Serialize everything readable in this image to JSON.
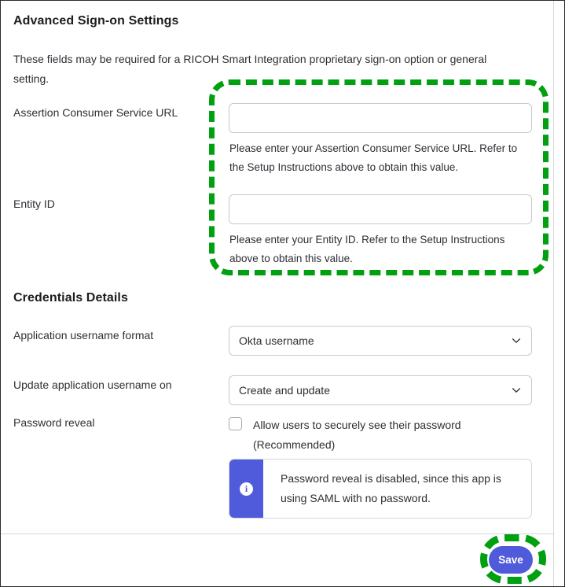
{
  "page": {
    "advanced_section_title": "Advanced Sign-on Settings",
    "intro_text": "These fields may be required for a RICOH Smart Integration proprietary sign-on option or general setting.",
    "credentials_section_title": "Credentials Details"
  },
  "fields": {
    "acs_url": {
      "label": "Assertion Consumer Service URL",
      "value": "",
      "placeholder": "",
      "hint": "Please enter your Assertion Consumer Service URL. Refer to the Setup Instructions above to obtain this value."
    },
    "entity_id": {
      "label": "Entity ID",
      "value": "",
      "placeholder": "",
      "hint": "Please enter your Entity ID. Refer to the Setup Instructions above to obtain this value."
    }
  },
  "credentials": {
    "app_username_format": {
      "label": "Application username format",
      "selected": "Okta username"
    },
    "update_application_username_on": {
      "label": "Update application username on",
      "selected": "Create and update"
    },
    "password_reveal": {
      "label": "Password reveal",
      "checkbox_label": "Allow users to securely see their password (Recommended)",
      "checked": false,
      "callout_text": "Password reveal is disabled, since this app is using SAML with no password.",
      "callout_icon": "info-icon"
    }
  },
  "footer": {
    "save_label": "Save"
  },
  "icons": {
    "chevron_down": "chevron-down-icon",
    "info": "info-icon"
  },
  "colors": {
    "accent_blue": "#4f5bda",
    "highlight_green": "#00a010",
    "border_gray": "#c8c8d0",
    "text": "#2e2e35"
  }
}
